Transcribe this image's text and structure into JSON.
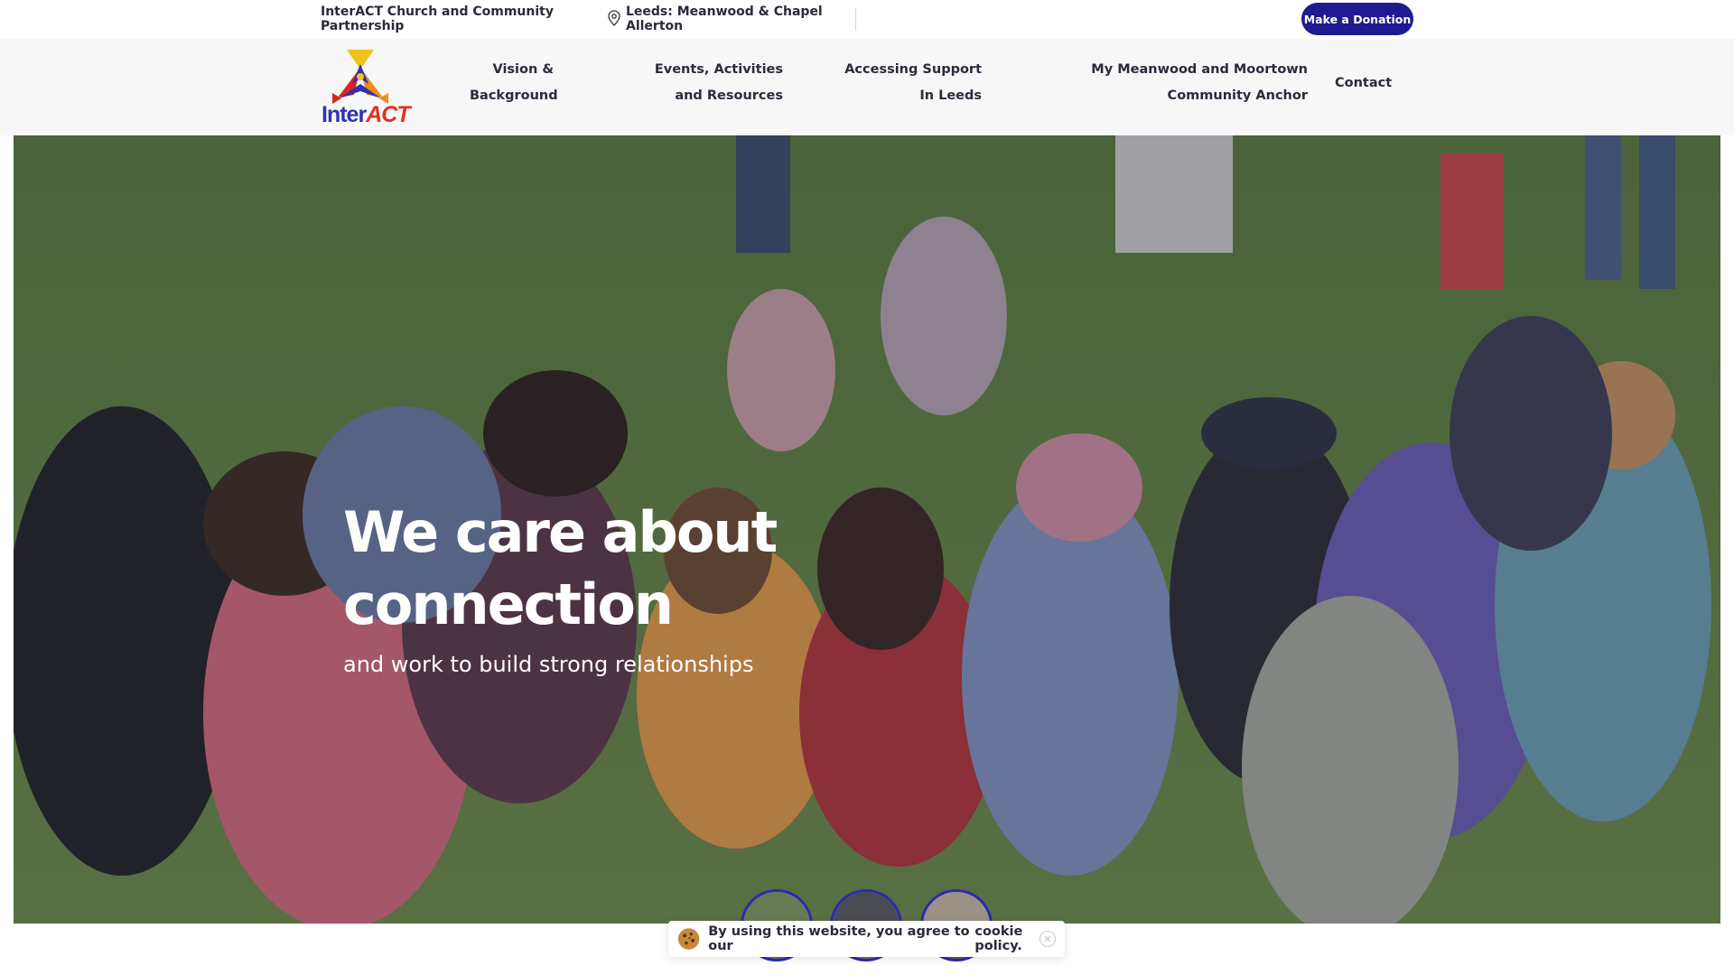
{
  "topbar": {
    "org_name": "InterACT Church and Community Partnership",
    "location": "Leeds: Meanwood & Chapel Allerton",
    "donate_label": "Make a Donation"
  },
  "logo": {
    "part1": "Inter",
    "part2": "ACT"
  },
  "nav": {
    "items": [
      {
        "label": "Vision & Background"
      },
      {
        "label": "Events, Activities and Resources"
      },
      {
        "label": "Accessing Support In Leeds"
      },
      {
        "label": "My Meanwood and Moortown Community Anchor"
      },
      {
        "label": "Contact"
      }
    ]
  },
  "hero": {
    "title": "We care about connection",
    "subtitle": "and work to build strong relationships"
  },
  "cookie": {
    "text": "By using this website, you agree to our",
    "link": "cookie policy.",
    "close": "✕"
  },
  "colors": {
    "accent": "#1d1b8f",
    "thumb_border": "#2c2ab0"
  }
}
